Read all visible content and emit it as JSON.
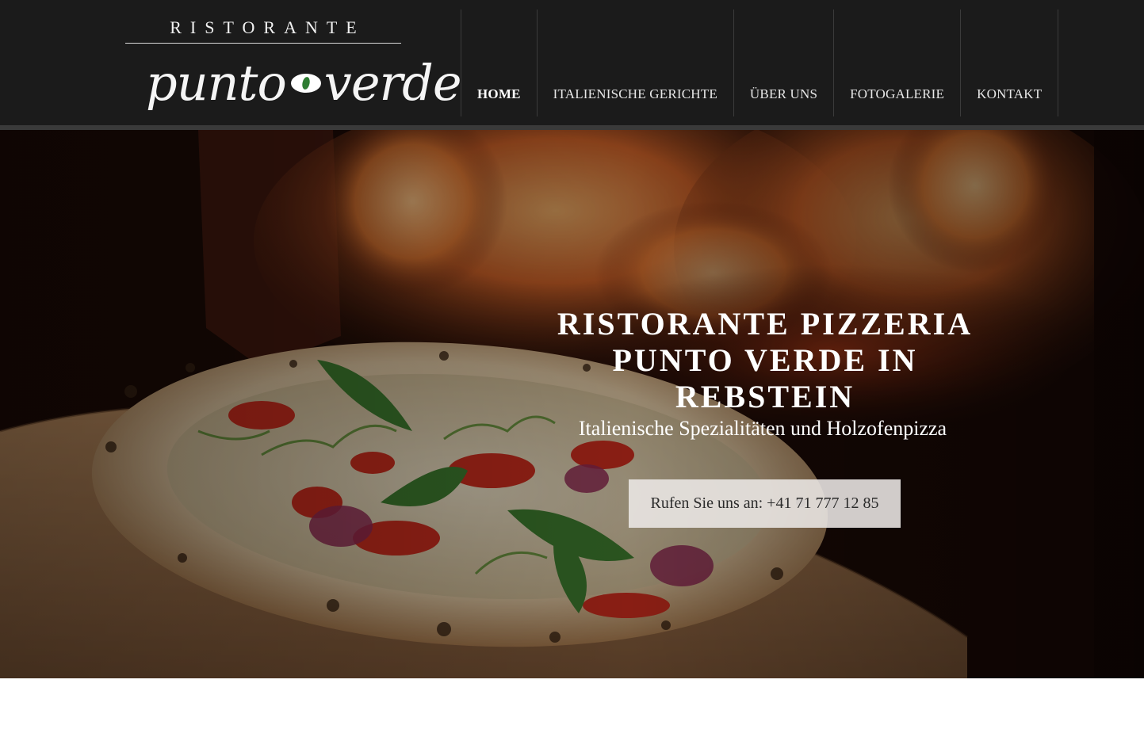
{
  "logo": {
    "top_text": "RISTORANTE",
    "script_word_1": "punto",
    "script_word_2": "verde"
  },
  "nav": {
    "items": [
      {
        "label": "HOME",
        "active": true
      },
      {
        "label": "ITALIENISCHE GERICHTE",
        "active": false
      },
      {
        "label": "ÜBER UNS",
        "active": false
      },
      {
        "label": "FOTOGALERIE",
        "active": false
      },
      {
        "label": "KONTAKT",
        "active": false
      }
    ]
  },
  "hero": {
    "title_line_1": "RISTORANTE PIZZERIA",
    "title_line_2": "PUNTO VERDE IN",
    "title_line_3": "REBSTEIN",
    "subtitle": "Italienische Spezialitäten und Holzofenpizza",
    "cta_label": "Rufen Sie uns an: +41 71 777 12 85",
    "image": "wood-fired-pizza-in-oven"
  },
  "colors": {
    "header_bg": "#1b1b1b",
    "text_light": "#ffffff",
    "logo_accent": "#2e7d32"
  }
}
